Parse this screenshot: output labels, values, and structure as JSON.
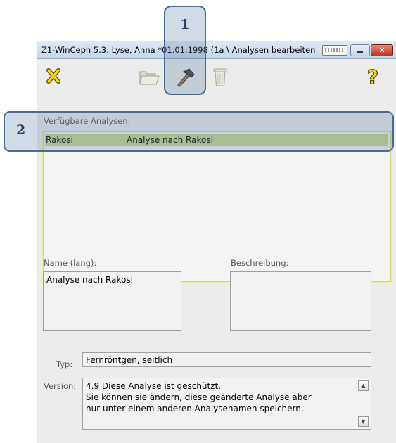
{
  "window": {
    "title": "Z1-WinCeph 5.3: Lyse, Anna *01.01.1998 (1a \\ Analysen bearbeiten",
    "close_symbol": "✕"
  },
  "toolbar": {
    "items": [
      {
        "icon": "cancel-x-icon"
      },
      {
        "icon": "folder-open-icon"
      },
      {
        "icon": "hammer-icon"
      },
      {
        "icon": "trash-can-icon"
      },
      {
        "icon": "help-question-icon"
      }
    ]
  },
  "analyses": {
    "label": "Verfügbare Analysen:",
    "rows": [
      {
        "name": "Rakosi",
        "description": "Analyse nach Rakosi"
      }
    ]
  },
  "name_field": {
    "label_pre": "Name (",
    "label_ul": "l",
    "label_post": "ang):",
    "value": "Analyse nach Rakosi"
  },
  "description_field": {
    "label_ul": "B",
    "label_post": "eschreibung:",
    "value": ""
  },
  "type_field": {
    "label": "Typ:",
    "value": "Fernröntgen, seitlich"
  },
  "version_field": {
    "label": "Version:",
    "lines": [
      "4.9 Diese Analyse ist geschützt.",
      "Sie können sie ändern, diese geänderte Analyse aber",
      "nur unter einem anderen Analysenamen speichern."
    ],
    "scroll_up": "▲",
    "scroll_down": "▼"
  },
  "callouts": [
    {
      "number": "1"
    },
    {
      "number": "2"
    }
  ],
  "colors": {
    "selection": "#c9d58a",
    "callout_border": "#4d6a8f",
    "callout_fill": "rgba(90,125,165,0.28)",
    "close_button": "#c2321f"
  }
}
